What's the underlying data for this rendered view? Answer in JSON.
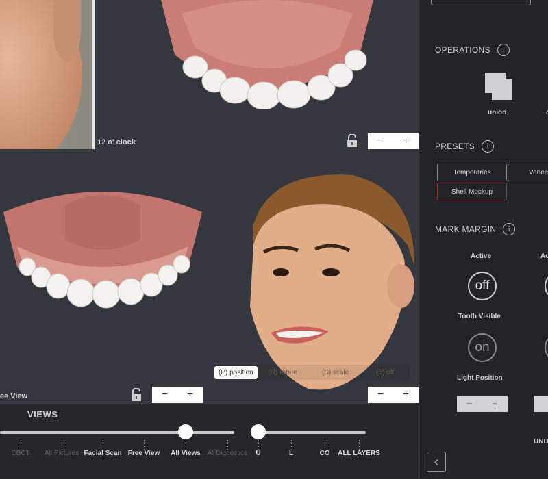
{
  "viewport": {
    "photo_caption": "12 o' clock",
    "free_view_caption": "ee View",
    "zoom_minus": "−",
    "zoom_plus": "+",
    "modes": [
      {
        "label": "(P) position",
        "active": true
      },
      {
        "label": "(R) rotate",
        "active": false
      },
      {
        "label": "(S) scale",
        "active": false
      },
      {
        "label": "(o) off",
        "active": false
      }
    ]
  },
  "views": {
    "title": "VIEWS",
    "ticks": [
      {
        "label": "CBCT",
        "state": "dim"
      },
      {
        "label": "All Pictures",
        "state": "dim"
      },
      {
        "label": "Facial Scan",
        "state": "lit"
      },
      {
        "label": "Free View",
        "state": "lit"
      },
      {
        "label": "All Views",
        "state": "lit"
      },
      {
        "label": "AI Dignostics",
        "state": "dim"
      }
    ],
    "selected": "All Views",
    "layers": [
      {
        "label": "U"
      },
      {
        "label": "L"
      },
      {
        "label": "CO"
      },
      {
        "label": "ALL LAYERS"
      }
    ],
    "selected_layer": "U"
  },
  "sidebar": {
    "operations_title": "OPERATIONS",
    "operation_union": "union",
    "operation_second_partial": "c",
    "presets_title": "PRESETS",
    "presets": [
      {
        "label": "Temporaries",
        "selected": false
      },
      {
        "label": "Venee",
        "selected": false
      },
      {
        "label": "Shell Mockup",
        "selected": true
      }
    ],
    "mark_margin_title": "MARK MARGIN",
    "active_label": "Active",
    "active_label_2": "Ac",
    "active_state": "off",
    "tooth_visible_label": "Tooth Visible",
    "tooth_visible_state": "on",
    "light_position_label": "Light Position",
    "pm_minus": "−",
    "pm_plus": "+",
    "undo_partial": "UND",
    "info_glyph": "i",
    "back_glyph": "‹"
  },
  "colors": {
    "viewport_bg": "#34373d",
    "sidebar_bg": "#222429",
    "selected_preset_border": "#8a3a32"
  }
}
